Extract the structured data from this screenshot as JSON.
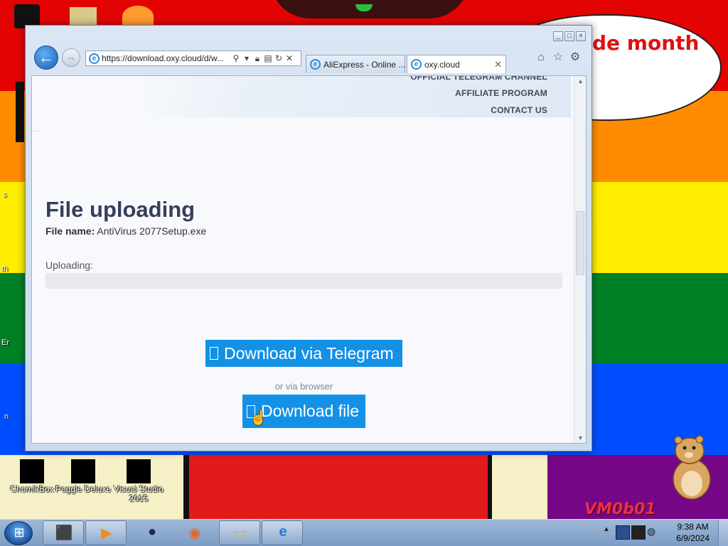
{
  "desktop": {
    "speech_text": "de month",
    "watermark": "VM0b01",
    "icons": [
      {
        "label": "ChomikBox"
      },
      {
        "label": "Peggle Deluxe"
      },
      {
        "label": "Visual Studio 2015"
      }
    ]
  },
  "browser": {
    "address": "https://download.oxy.cloud/d/w...",
    "tabs": [
      {
        "label": "AliExpress - Online ..."
      },
      {
        "label": "oxy.cloud"
      }
    ],
    "caption_buttons": [
      "_",
      "□",
      "×"
    ],
    "icons": {
      "home": "home-icon",
      "favorites": "star-icon",
      "tools": "gear-icon"
    }
  },
  "page": {
    "menu": [
      "OFFICIAL TELEGRAM CHANNEL",
      "AFFILIATE PROGRAM",
      "CONTACT US"
    ],
    "ellipsis": "...",
    "title": "File uploading",
    "file_name_label": "File name:",
    "file_name": "AntiVirus 2077Setup.exe",
    "uploading_label": "Uploading:",
    "upload_progress": 0,
    "telegram_button": "Download via Telegram",
    "or_via_browser": "or via browser",
    "download_button": "Download file"
  },
  "taskbar": {
    "time": "9:38 AM",
    "date": "6/9/2024"
  }
}
